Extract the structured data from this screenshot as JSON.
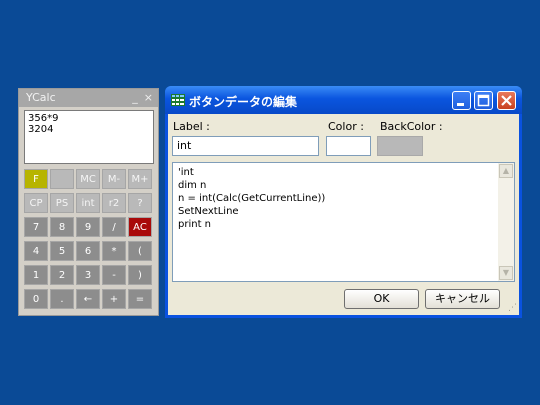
{
  "ycalc": {
    "title": "YCalc",
    "minimize": "_",
    "close": "×",
    "display_lines": [
      "356*9",
      "3204"
    ],
    "keys": [
      [
        "F",
        "",
        "MC",
        "M-",
        "M+"
      ],
      [
        "CP",
        "PS",
        "int",
        "r2",
        "?"
      ],
      [
        "7",
        "8",
        "9",
        "/",
        "AC"
      ],
      [
        "4",
        "5",
        "6",
        "*",
        "("
      ],
      [
        "1",
        "2",
        "3",
        "-",
        ")"
      ],
      [
        "0",
        ".",
        "←",
        "+",
        "="
      ]
    ],
    "colors": {
      "accent_key": "#b7b400",
      "clear_key": "#a90a0a"
    }
  },
  "dialog": {
    "title": "ボタンデータの編集",
    "label_caption": "Label :",
    "color_caption": "Color :",
    "backcolor_caption": "BackColor :",
    "label_value": "int",
    "color_value": "#ffffff",
    "backcolor_value": "#b8b8b8",
    "code_lines": [
      "'int",
      "dim n",
      "n = int(Calc(GetCurrentLine))",
      "SetNextLine",
      "print n"
    ],
    "ok_label": "OK",
    "cancel_label": "キャンセル"
  }
}
